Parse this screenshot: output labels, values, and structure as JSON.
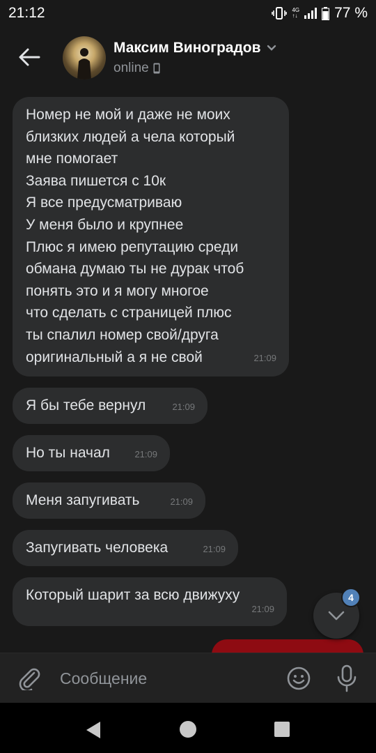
{
  "status_bar": {
    "time": "21:12",
    "network": "4G",
    "battery": "77 %"
  },
  "header": {
    "contact_name": "Максим Виноградов",
    "status": "online",
    "icons": [
      "back-arrow-icon",
      "chevron-down-icon",
      "mobile-phone-icon"
    ]
  },
  "messages": [
    {
      "text": "Номер не мой и даже не моих\nблизких людей а чела который\nмне помогает\nЗаява пишется с 10к\nЯ все предусматриваю\nУ меня было и крупнее\nПлюс я имею репутацию среди\nобмана думаю ты не дурак чтоб\nпонять это и я могу многое\nчто сделать с страницей плюс\nты спалил номер свой/друга\nоригинальный а я не свой",
      "time": "21:09"
    },
    {
      "text": "Я бы тебе вернул",
      "time": "21:09"
    },
    {
      "text": "Но ты начал",
      "time": "21:09"
    },
    {
      "text": "Меня запугивать",
      "time": "21:09"
    },
    {
      "text": "Запугивать человека",
      "time": "21:09"
    },
    {
      "text": "Который шарит за всю движуху",
      "time": "21:09"
    }
  ],
  "scroll_button": {
    "unread_count": "4"
  },
  "composer": {
    "placeholder": "Сообщение",
    "icons": [
      "paperclip-icon",
      "emoji-icon",
      "microphone-icon"
    ]
  },
  "colors": {
    "background": "#191919",
    "bubble_incoming": "#2c2d2e",
    "bubble_outgoing": "#8e0b12",
    "badge": "#5181b8",
    "muted_text": "#909499"
  }
}
